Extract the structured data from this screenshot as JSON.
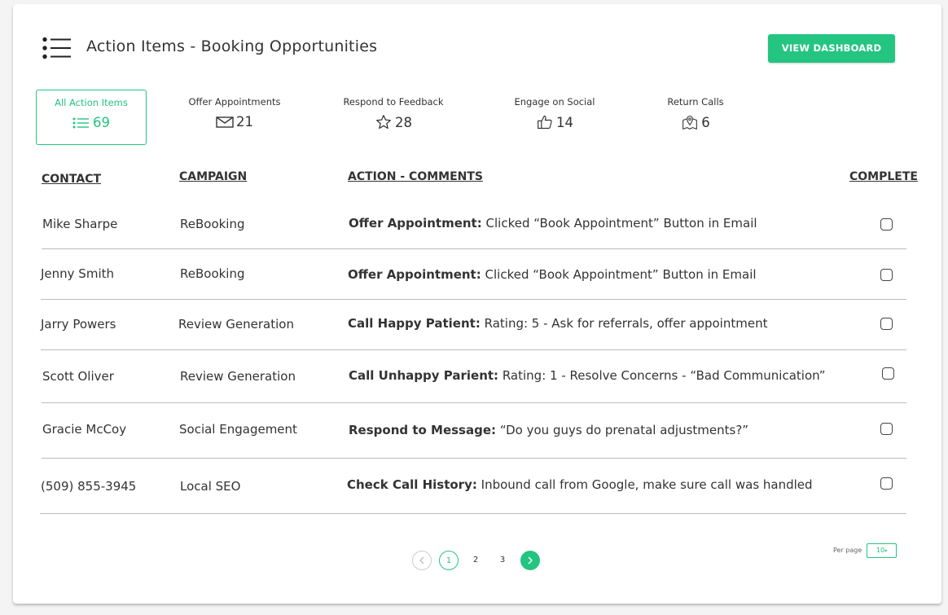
{
  "header": {
    "title": "Action Items - Booking Opportunities",
    "button_label": "VIEW DASHBOARD"
  },
  "stats": [
    {
      "label": "All Action Items",
      "value": "69",
      "icon": "list-icon"
    },
    {
      "label": "Offer Appointments",
      "value": "21",
      "icon": "envelope-icon"
    },
    {
      "label": "Respond to Feedback",
      "value": "28",
      "icon": "star-icon"
    },
    {
      "label": "Engage on Social",
      "value": "14",
      "icon": "thumbs-up-icon"
    },
    {
      "label": "Return Calls",
      "value": "6",
      "icon": "map-pin-icon"
    }
  ],
  "table": {
    "headers": {
      "contact": "CONTACT",
      "campaign": "CAMPAIGN",
      "action": "ACTION - COMMENTS",
      "complete": "COMPLETE"
    },
    "rows": [
      {
        "contact": "Mike Sharpe",
        "campaign": "ReBooking",
        "action_title": "Offer Appointment:",
        "action_comment": "Clicked “Book Appointment” Button in Email",
        "complete": false
      },
      {
        "contact": "Jenny Smith",
        "campaign": "ReBooking",
        "action_title": "Offer Appointment:",
        "action_comment": "Clicked “Book Appointment” Button in Email",
        "complete": false
      },
      {
        "contact": "Jarry Powers",
        "campaign": "Review Generation",
        "action_title": "Call Happy Patient:",
        "action_comment": "Rating: 5 - Ask for referrals, offer appointment",
        "complete": false
      },
      {
        "contact": "Scott Oliver",
        "campaign": "Review Generation",
        "action_title": "Call Unhappy Parient:",
        "action_comment": "Rating: 1 - Resolve Concerns - “Bad Communication”",
        "complete": false
      },
      {
        "contact": "Gracie McCoy",
        "campaign": "Social Engagement",
        "action_title": "Respond to Message:",
        "action_comment": "“Do you guys do prenatal adjustments?”",
        "complete": false
      },
      {
        "contact": "(509) 855-3945",
        "campaign": "Local SEO",
        "action_title": "Check Call History:",
        "action_comment": "Inbound call from Google, make sure call was handled",
        "complete": false
      }
    ]
  },
  "pagination": {
    "prev_icon": "chevron-left-icon",
    "pages": [
      "1",
      "2",
      "3"
    ],
    "current": "1",
    "next_icon": "chevron-right-icon",
    "per_page_label": "Per page",
    "per_page_value": "10"
  },
  "colors": {
    "accent": "#23c580",
    "text": "#333333",
    "divider": "#bcbcbc"
  }
}
